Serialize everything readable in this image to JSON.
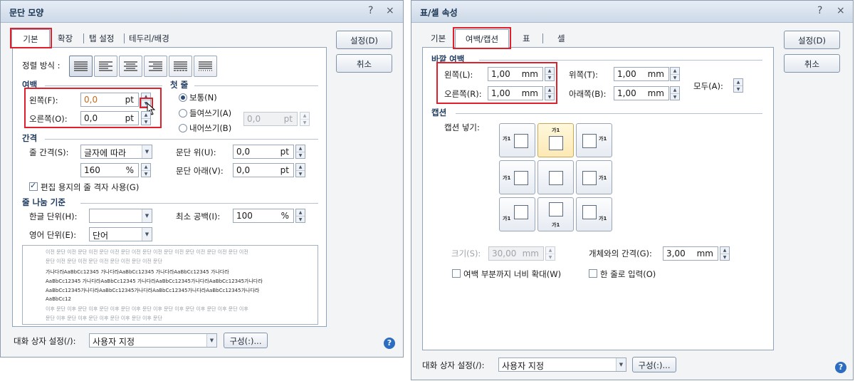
{
  "left": {
    "title": "문단 모양",
    "help_glyph": "?",
    "close_glyph": "×",
    "tabs": [
      "기본",
      "확장",
      "탭 설정",
      "테두리/배경"
    ],
    "buttons": {
      "ok": "설정(D)",
      "cancel": "취소"
    },
    "align": {
      "label": "정렬 방식 :",
      "options": [
        "양쪽 정렬",
        "왼쪽 정렬",
        "가운데 정렬",
        "오른쪽 정렬",
        "배분 정렬",
        "나눔 정렬"
      ],
      "selected": 0
    },
    "margin": {
      "group": "여백",
      "left_label": "왼쪽(F):",
      "left_value": "0,0",
      "left_unit": "pt",
      "right_label": "오른쪽(O):",
      "right_value": "0,0",
      "right_unit": "pt"
    },
    "first_line": {
      "group": "첫 줄",
      "options": [
        "보통(N)",
        "들여쓰기(A)",
        "내어쓰기(B)"
      ],
      "selected": 0,
      "value": "0,0",
      "unit": "pt"
    },
    "spacing": {
      "group": "간격",
      "line_label": "줄 간격(S):",
      "line_type": "글자에 따라",
      "line_value": "160",
      "line_unit": "%",
      "above_label": "문단 위(U):",
      "above_value": "0,0",
      "above_unit": "pt",
      "below_label": "문단 아래(V):",
      "below_value": "0,0",
      "below_unit": "pt",
      "grid_check_label": "편집 용지의 줄 격자 사용(G)",
      "grid_checked": true
    },
    "break": {
      "group": "줄 나눔 기준",
      "hangul_label": "한글 단위(H):",
      "hangul_value": "",
      "english_label": "영어 단위(E):",
      "english_value": "단어",
      "min_space_label": "최소 공백(I):",
      "min_space_value": "100",
      "min_space_unit": "%"
    },
    "preview": {
      "prev_lines": [
        "이전 문단 이전 문단 이전 문단 이전 문단 이전 문단 이전 문단 이전 문단 이전 문단 이전 문단 이전",
        "문단 이전 문단 이전 문단 이전 문단 이전 문단 이전 문단"
      ],
      "sample_lines": [
        "가나다라AaBbCc12345      가나다라AaBbCc12345      가나다라AaBbCc12345      가나다라",
        "AaBbCc12345 가나다라AaBbCc12345 가나다라AaBbCc12345가나다라AaBbCc12345가나다라",
        "AaBbCc12345가나다라AaBbCc12345가나다라AaBbCc12345가나다라AaBbCc12345가나다라",
        "AaBbCc12"
      ],
      "next_lines": [
        "이후 문단 이후 문단 이후 문단 이후 문단 이후 문단 이후 문단 이후 문단 이후 문단 이후 문단 이후",
        "문단 이후 문단 이후 문단 이후 문단 이후 문단 이후 문단"
      ]
    },
    "footer": {
      "label": "대화 상자 설정(/):",
      "value": "사용자 지정",
      "config_button": "구성(:)..."
    }
  },
  "right": {
    "title": "표/셀 속성",
    "help_glyph": "?",
    "close_glyph": "×",
    "tabs": [
      "기본",
      "여백/캡션",
      "표",
      "셀"
    ],
    "buttons": {
      "ok": "설정(D)",
      "cancel": "취소"
    },
    "outer_margin": {
      "group": "바깥 여백",
      "left_label": "왼쪽(L):",
      "left_value": "1,00",
      "left_unit": "mm",
      "right_label": "오른쪽(R):",
      "right_value": "1,00",
      "right_unit": "mm",
      "top_label": "위쪽(T):",
      "top_value": "1,00",
      "top_unit": "mm",
      "bottom_label": "아래쪽(B):",
      "bottom_value": "1,00",
      "bottom_unit": "mm",
      "all_label": "모두(A):"
    },
    "caption": {
      "group": "캡션",
      "insert_label": "캡션 넣기:",
      "cell_text": "가1",
      "selected": 1,
      "size_label": "크기(S):",
      "size_value": "30,00",
      "size_unit": "mm",
      "gap_label": "개체와의 간격(G):",
      "gap_value": "3,00",
      "gap_unit": "mm",
      "expand_label": "여백 부분까지 너비 확대(W)",
      "expand_checked": false,
      "oneline_label": "한 줄로 입력(O)",
      "oneline_checked": false
    },
    "footer": {
      "label": "대화 상자 설정(/):",
      "value": "사용자 지정",
      "config_button": "구성(:)..."
    }
  }
}
